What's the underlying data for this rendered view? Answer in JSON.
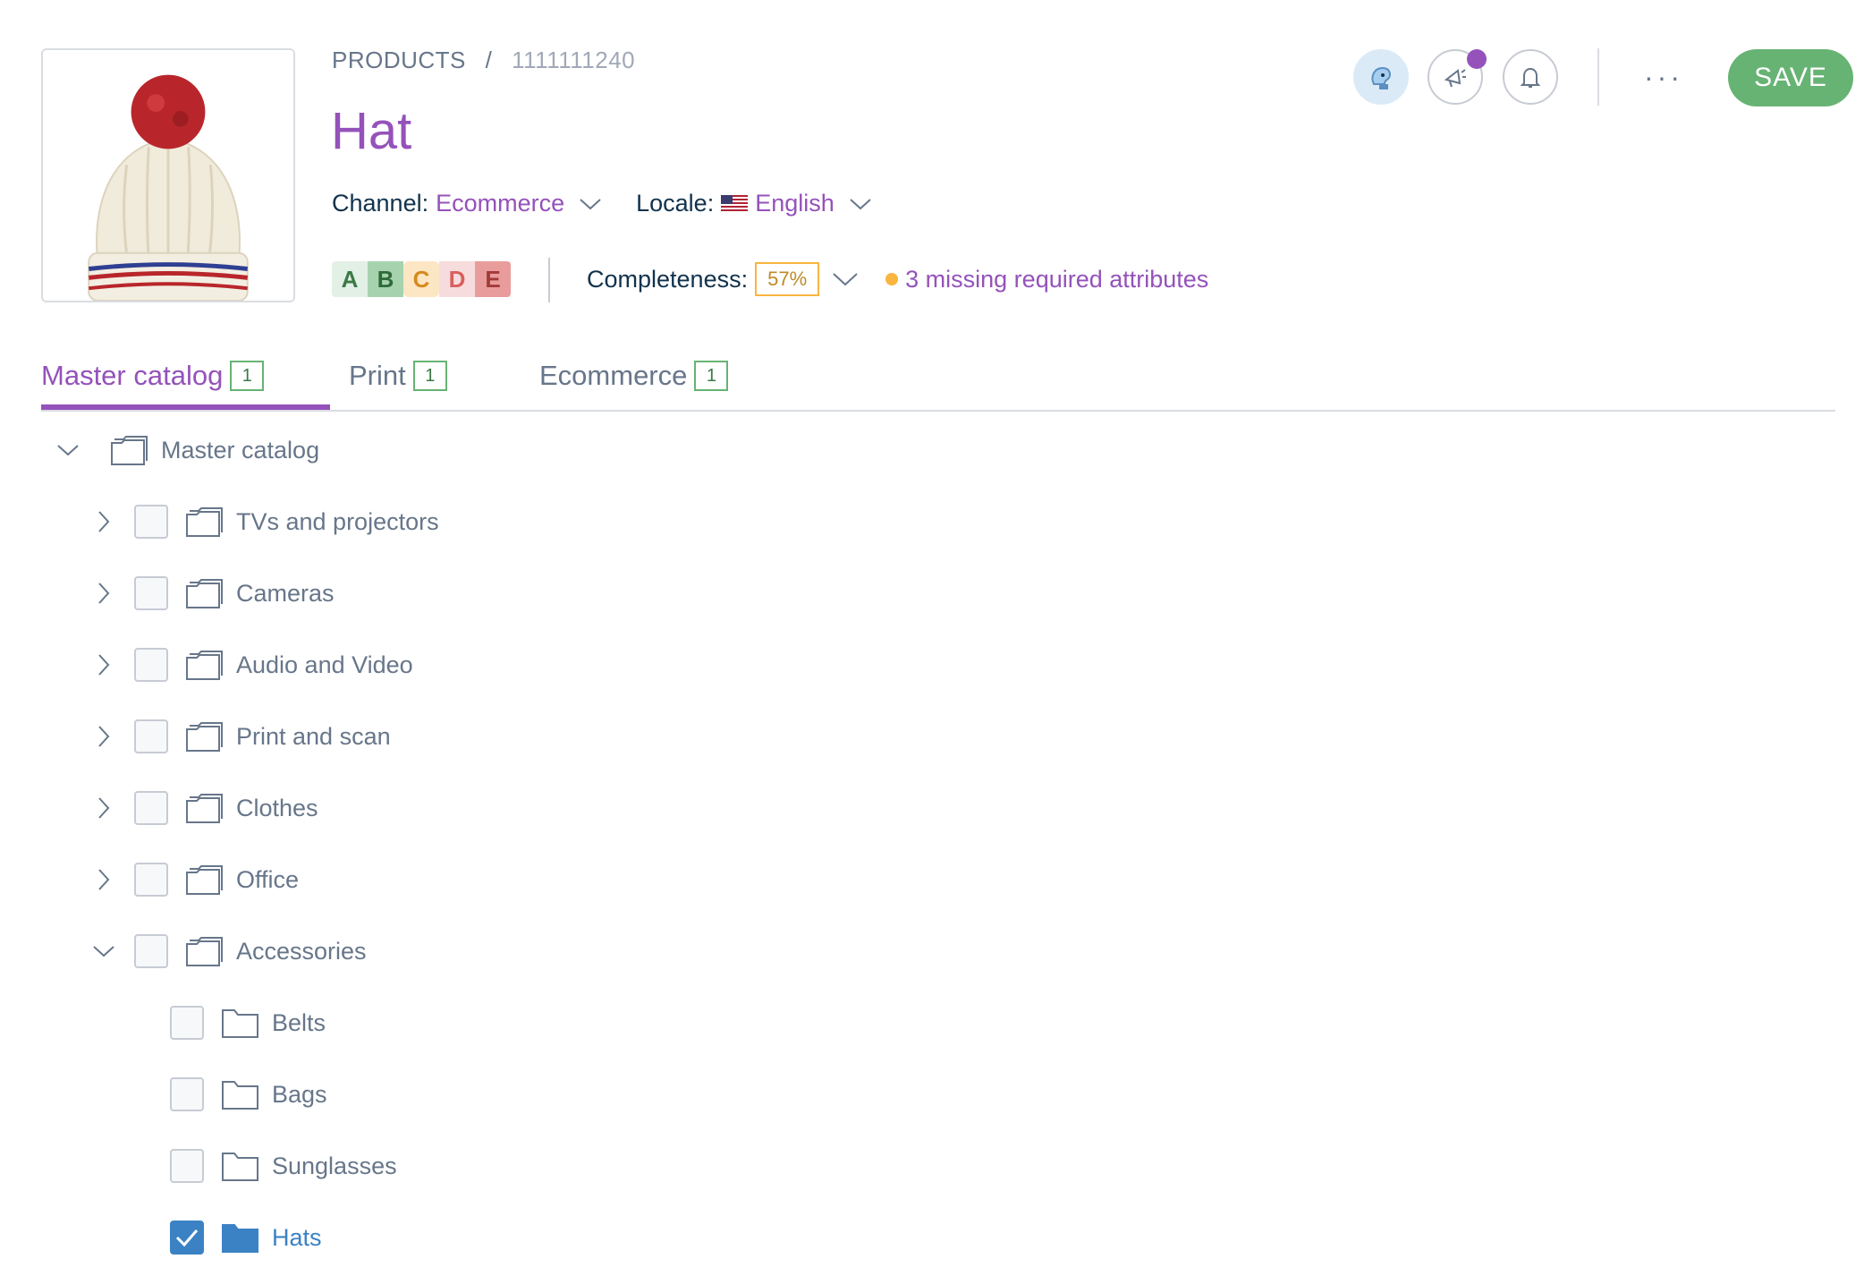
{
  "product": {
    "image_alt": "Hat",
    "breadcrumb_root": "PRODUCTS",
    "breadcrumb_separator": "/",
    "breadcrumb_id": "1111111240",
    "title": "Hat"
  },
  "context": {
    "channel_label": "Channel:",
    "channel_value": "Ecommerce",
    "locale_label": "Locale:",
    "locale_value": "English",
    "locale_flag": "us-flag-icon"
  },
  "quality": {
    "grades": [
      {
        "letter": "A",
        "bg": "#e3f0e6",
        "fg": "#3b7a45"
      },
      {
        "letter": "B",
        "bg": "#a6d3ae",
        "fg": "#2f6a3a"
      },
      {
        "letter": "C",
        "bg": "#fde6c4",
        "fg": "#d68a1f"
      },
      {
        "letter": "D",
        "bg": "#f7dcdd",
        "fg": "#d95f5f"
      },
      {
        "letter": "E",
        "bg": "#e99c9c",
        "fg": "#a33a3a"
      }
    ],
    "active_grade": "C",
    "completeness_label": "Completeness:",
    "completeness_value": "57%",
    "missing_text": "3 missing required attributes"
  },
  "actions": {
    "avatar_icon": "user-avatar-icon",
    "announcement_icon": "megaphone-icon",
    "notification_icon": "bell-icon",
    "more_label": "···",
    "save_label": "SAVE"
  },
  "tabs": [
    {
      "label": "Master catalog",
      "count": "1",
      "active": true
    },
    {
      "label": "Print",
      "count": "1",
      "active": false
    },
    {
      "label": "Ecommerce",
      "count": "1",
      "active": false
    }
  ],
  "tree": {
    "root": {
      "label": "Master catalog",
      "expanded": true
    },
    "items": [
      {
        "label": "TVs and projectors",
        "level": 1,
        "expanded": false,
        "checked": false
      },
      {
        "label": "Cameras",
        "level": 1,
        "expanded": false,
        "checked": false
      },
      {
        "label": "Audio and Video",
        "level": 1,
        "expanded": false,
        "checked": false
      },
      {
        "label": "Print and scan",
        "level": 1,
        "expanded": false,
        "checked": false
      },
      {
        "label": "Clothes",
        "level": 1,
        "expanded": false,
        "checked": false
      },
      {
        "label": "Office",
        "level": 1,
        "expanded": false,
        "checked": false
      },
      {
        "label": "Accessories",
        "level": 1,
        "expanded": true,
        "checked": false
      },
      {
        "label": "Belts",
        "level": 2,
        "leaf": true,
        "checked": false
      },
      {
        "label": "Bags",
        "level": 2,
        "leaf": true,
        "checked": false
      },
      {
        "label": "Sunglasses",
        "level": 2,
        "leaf": true,
        "checked": false
      },
      {
        "label": "Hats",
        "level": 2,
        "leaf": true,
        "checked": true
      }
    ]
  },
  "colors": {
    "brand_purple": "#9452ba",
    "save_green": "#67b373",
    "selected_blue": "#3b82c4",
    "warning_orange": "#f9b53f"
  }
}
